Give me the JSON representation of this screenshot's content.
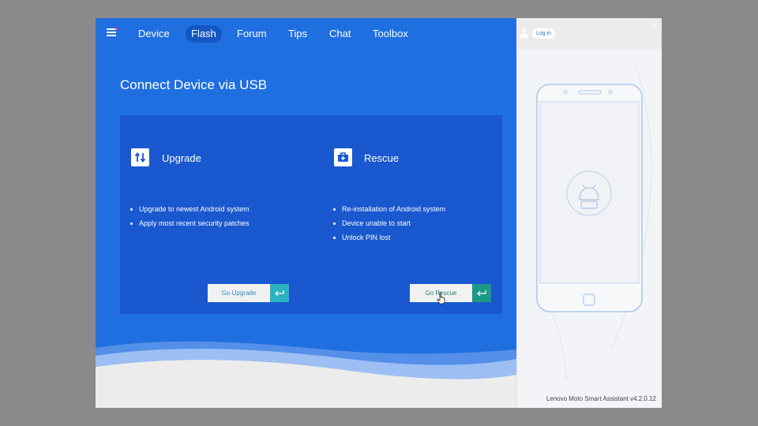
{
  "nav": {
    "items": [
      {
        "label": "Device"
      },
      {
        "label": "Flash"
      },
      {
        "label": "Forum"
      },
      {
        "label": "Tips"
      },
      {
        "label": "Chat"
      },
      {
        "label": "Toolbox"
      }
    ],
    "active": "Flash",
    "login_label": "Log in",
    "minimize_glyph": "–",
    "close_glyph": "✕"
  },
  "page": {
    "title": "Connect Device via USB"
  },
  "upgrade": {
    "title": "Upgrade",
    "icon": "upgrade-arrows-icon",
    "bullets": [
      "Upgrade to newest Android system",
      "Apply most recent security patches"
    ],
    "button_label": "Go Upgrade"
  },
  "rescue": {
    "title": "Rescue",
    "icon": "rescue-toolbox-icon",
    "bullets": [
      "Re-installation of Android system",
      "Device unable to start",
      "Unlock PIN lost"
    ],
    "button_label": "Go Rescue"
  },
  "footer": {
    "version": "Lenovo Moto Smart Assistant v4.2.0.12"
  },
  "colors": {
    "primary_blue": "#1f6fe0",
    "panel_blue": "#1958cf",
    "upgrade_accent": "#2bb3c0",
    "rescue_accent": "#1a9a86",
    "phone_outline": "#a9c8f0"
  }
}
